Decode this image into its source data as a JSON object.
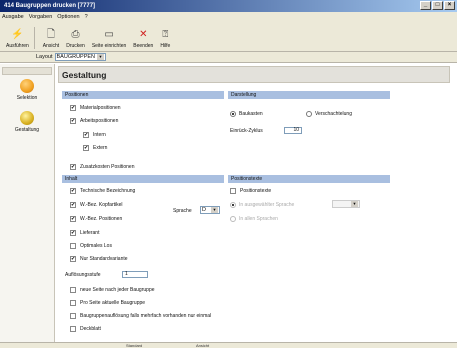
{
  "window": {
    "title": "414 Baugruppen drucken [7777]"
  },
  "menu": [
    "Ausgabe",
    "Vorgaben",
    "Optionen",
    "?"
  ],
  "toolbar": [
    {
      "label": "Ausführen",
      "icon": "run-icon"
    },
    {
      "label": "Ansicht",
      "icon": "view-icon"
    },
    {
      "label": "Drucken",
      "icon": "print-icon"
    },
    {
      "label": "Seite einrichten",
      "icon": "page-setup-icon"
    },
    {
      "label": "Beenden",
      "icon": "close-red-x-icon"
    },
    {
      "label": "Hilfe",
      "icon": "help-icon"
    }
  ],
  "layout": {
    "label": "Layout",
    "value": "BAUGRUPPEN"
  },
  "sidebar": [
    {
      "label": "Selektion",
      "color": "#f0a020"
    },
    {
      "label": "Gestaltung",
      "color": "#d8b020"
    }
  ],
  "main": {
    "title": "Gestaltung",
    "positionen": {
      "header": "Positionen",
      "items": [
        {
          "label": "Materialpositionen",
          "checked": true
        },
        {
          "label": "Arbeitspositionen",
          "checked": true
        },
        {
          "label": "Intern",
          "checked": true
        },
        {
          "label": "Extern",
          "checked": true
        },
        {
          "label": "Zusatzkosten Positionen",
          "checked": true
        }
      ]
    },
    "darstellung": {
      "header": "Darstellung",
      "radio_baukasten": "Baukasten",
      "radio_verschachtelung": "Verschachtelung",
      "einrueck_label": "Einrück-Zyklus",
      "einrueck_value": "10"
    },
    "inhalt": {
      "header": "Inhalt",
      "items": [
        {
          "label": "Technische Bezeichnung",
          "checked": true
        },
        {
          "label": "W.-Bez. Kopfartikel",
          "checked": true
        },
        {
          "label": "W.-Bez. Positionen",
          "checked": true
        },
        {
          "label": "Lieferant",
          "checked": true
        },
        {
          "label": "Optimales Los",
          "checked": false
        },
        {
          "label": "Nur Standardvariante",
          "checked": true
        }
      ],
      "sprache_label": "Sprache",
      "sprache_value": "D"
    },
    "positionstexte": {
      "header": "Positionstexte",
      "checkbox": "Positionstexte",
      "radio_ausgewaehlt": "In ausgewählter Sprache",
      "radio_alle": "In allen Sprachen"
    },
    "aufloesung": {
      "label": "Auflösungsstufe",
      "value": "1"
    },
    "extra_options": [
      {
        "label": "neue Seite nach jeder Baugruppe",
        "checked": false
      },
      {
        "label": "Pro Seite aktuelle Baugruppe",
        "checked": false
      },
      {
        "label": "Baugruppenauflösung falls mehrfach vorhanden nur einmal",
        "checked": false
      },
      {
        "label": "Deckblatt",
        "checked": false
      }
    ]
  },
  "status": {
    "left": "Standard",
    "right": "Ansicht"
  },
  "colors": {
    "section_header": "#a9bfe0",
    "title_gradient_start": "#0a246a"
  }
}
